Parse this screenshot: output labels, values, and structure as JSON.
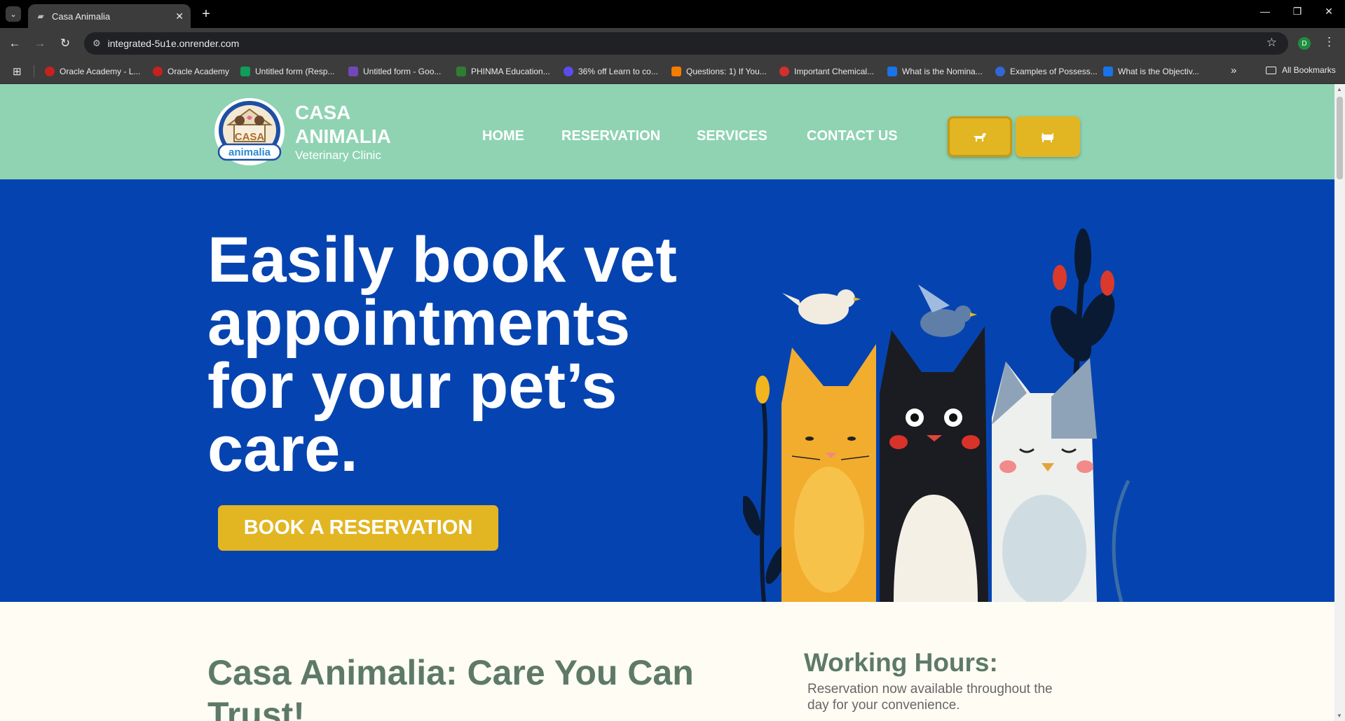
{
  "browser": {
    "tab_title": "Casa Animalia",
    "url": "integrated-5u1e.onrender.com",
    "profile_initial": "D",
    "bookmarks": [
      {
        "label": "Oracle Academy - L...",
        "color": "#c5221f"
      },
      {
        "label": "Oracle Academy",
        "color": "#c5221f"
      },
      {
        "label": "Untitled form (Resp...",
        "color": "#0f9d58"
      },
      {
        "label": "Untitled form - Goo...",
        "color": "#7248b9"
      },
      {
        "label": "PHINMA Education...",
        "color": "#2e7d32"
      },
      {
        "label": "36% off Learn to co...",
        "color": "#5b4cf0"
      },
      {
        "label": "Questions: 1) If You...",
        "color": "#f57c00"
      },
      {
        "label": "Important Chemical...",
        "color": "#d32f2f"
      },
      {
        "label": "What is the Nomina...",
        "color": "#1a73e8"
      },
      {
        "label": "Examples of Possess...",
        "color": "#3367d6"
      },
      {
        "label": "What is the Objectiv...",
        "color": "#1a73e8"
      }
    ],
    "all_bookmarks": "All Bookmarks"
  },
  "site": {
    "brand": {
      "line1": "CASA",
      "line2": "ANIMALIA",
      "subtitle": "Veterinary Clinic",
      "logo_text_top": "CASA",
      "logo_text_bottom": "animalia"
    },
    "nav": [
      "HOME",
      "RESERVATION",
      "SERVICES",
      "CONTACT US"
    ],
    "header_buttons": [
      {
        "icon": "dog-icon"
      },
      {
        "icon": "cat-icon"
      }
    ],
    "hero": {
      "title": "Easily book vet appointments for your pet’s care.",
      "cta": "BOOK A RESERVATION"
    },
    "about": {
      "title": "Casa Animalia: Care You Can Trust!"
    },
    "hours": {
      "title": "Working Hours:",
      "text": "Reservation now available throughout the day for your convenience."
    }
  },
  "colors": {
    "header_bg": "#8fd3b3",
    "hero_bg": "#0544b0",
    "accent": "#e2b523",
    "heading_green": "#5d7a67",
    "page_bg": "#fefcf3"
  }
}
